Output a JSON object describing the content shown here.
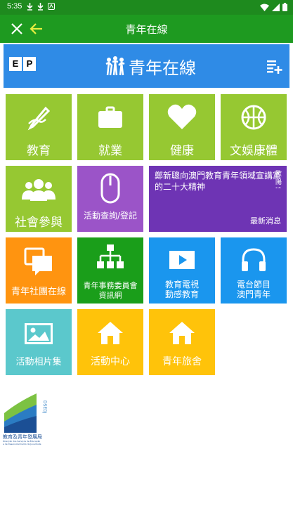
{
  "status": {
    "time": "5:35"
  },
  "appbar": {
    "title": "青年在線"
  },
  "banner": {
    "lang_e": "E",
    "lang_p": "P",
    "title": "青年在線"
  },
  "tiles": {
    "education": "教育",
    "employment": "就業",
    "health": "健康",
    "culture": "文娛康體",
    "social": "社會參與",
    "activity_query": "活動查詢/登記",
    "news_headline": "鄭新聰向澳門教育青年領域宣講黨的二十大精神",
    "news_side": "歐陽瑜",
    "news_more": "最新消息",
    "youth_assoc": "青年社團在線",
    "committee_line1": "青年事務委員會",
    "committee_line2": "資訊網",
    "tv_line1": "教育電視",
    "tv_line2": "動感教育",
    "radio_line1": "電台節目",
    "radio_line2": "澳門青年",
    "photo_album": "活動相片集",
    "activity_center": "活動中心",
    "hostel": "青年旅舍"
  },
  "footer": {
    "logo_name": "教育及青年發展局",
    "logo_sub1": "Direcção dos Serviços de Educação",
    "logo_sub2": "e de Desenvolvimento da Juventude",
    "logo_abbr": "DSEDJ"
  },
  "colors": {
    "statusbar": "#1e8a1e",
    "appbar": "#1e9a20",
    "banner": "#2f8be6",
    "lime": "#96c832",
    "purple": "#9b54c8",
    "deep_purple": "#6e34b4",
    "orange": "#ff9410",
    "green": "#1a9e1a",
    "blue": "#1a96ee",
    "teal": "#5bc8cc",
    "yellow": "#ffc30a"
  }
}
